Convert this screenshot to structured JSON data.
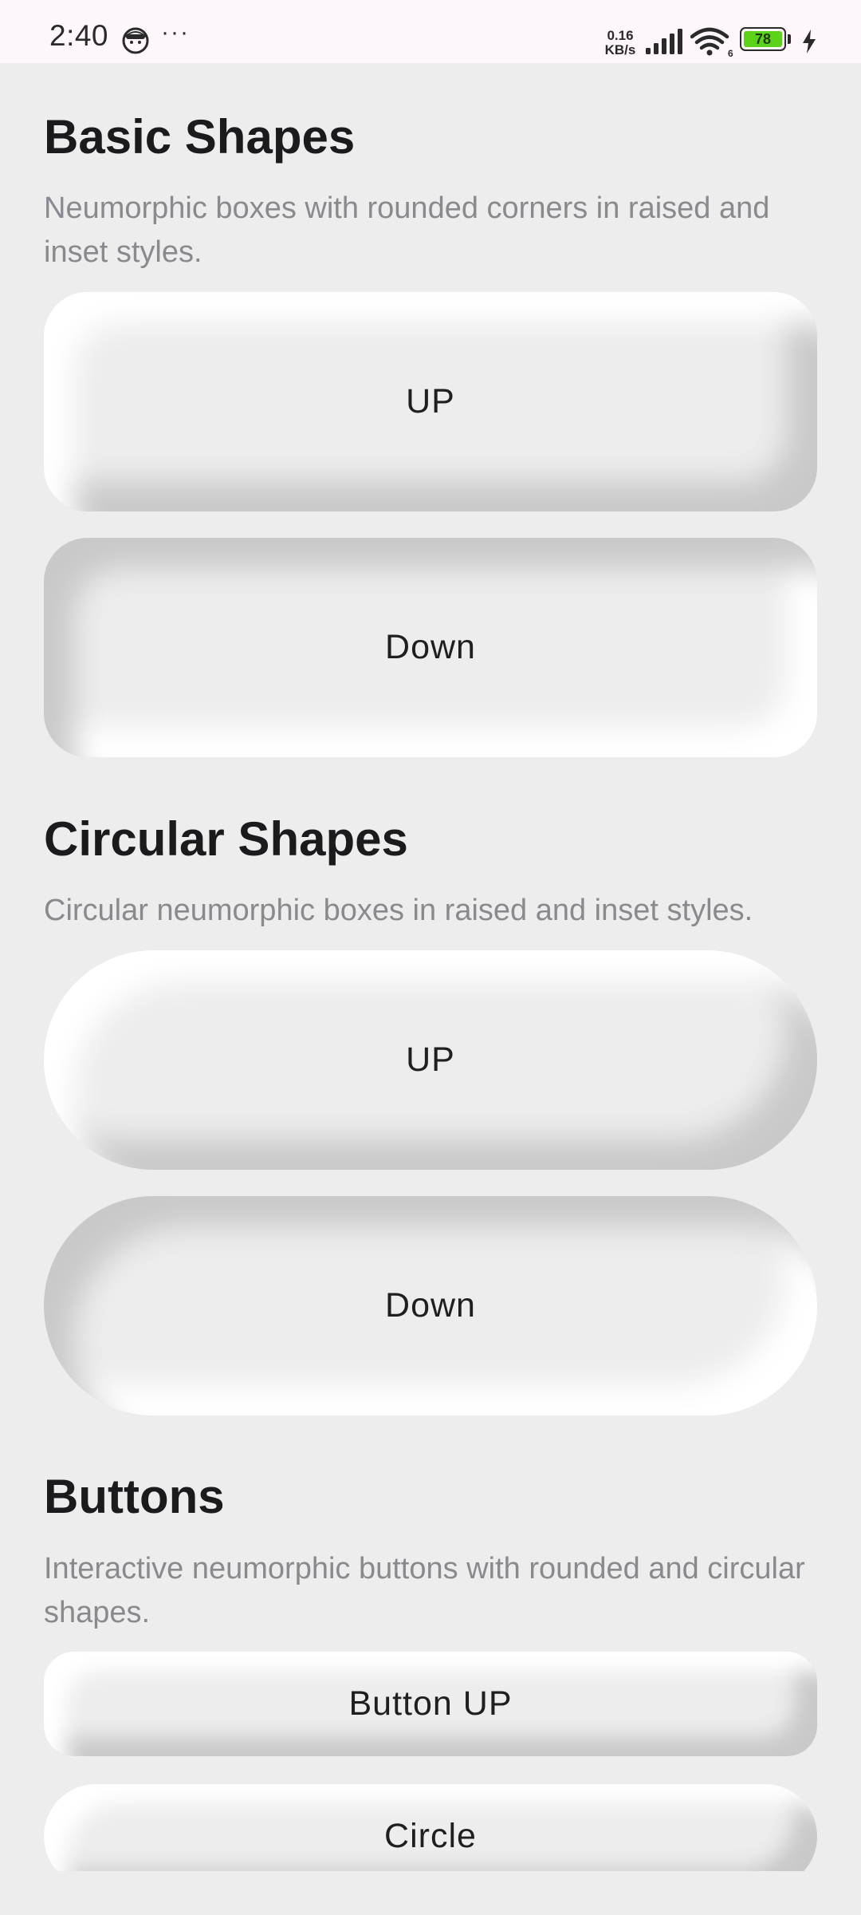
{
  "status_bar": {
    "time": "2:40",
    "more_indicator": "···",
    "net_speed_value": "0.16",
    "net_speed_unit": "KB/s",
    "wifi_badge": "6",
    "battery_level": "78",
    "battery_color": "#5cd21b",
    "icons": [
      "face-icon",
      "signal-icon",
      "wifi-icon",
      "battery-icon",
      "charging-icon"
    ]
  },
  "sections": {
    "basic": {
      "title": "Basic Shapes",
      "description": "Neumorphic boxes with rounded corners in raised and inset styles.",
      "up_label": "UP",
      "down_label": "Down"
    },
    "circular": {
      "title": "Circular Shapes",
      "description": "Circular neumorphic boxes in raised and inset styles.",
      "up_label": "UP",
      "down_label": "Down"
    },
    "buttons": {
      "title": "Buttons",
      "description": "Interactive neumorphic buttons with rounded and circular shapes.",
      "button_up_label": "Button UP",
      "circle_label": "Circle"
    }
  },
  "colors": {
    "background": "#ededed",
    "highlight": "#ffffff",
    "shadow": "#c9c9c9",
    "title_text": "#1b1b1d",
    "description_text": "#8a8a8e"
  }
}
